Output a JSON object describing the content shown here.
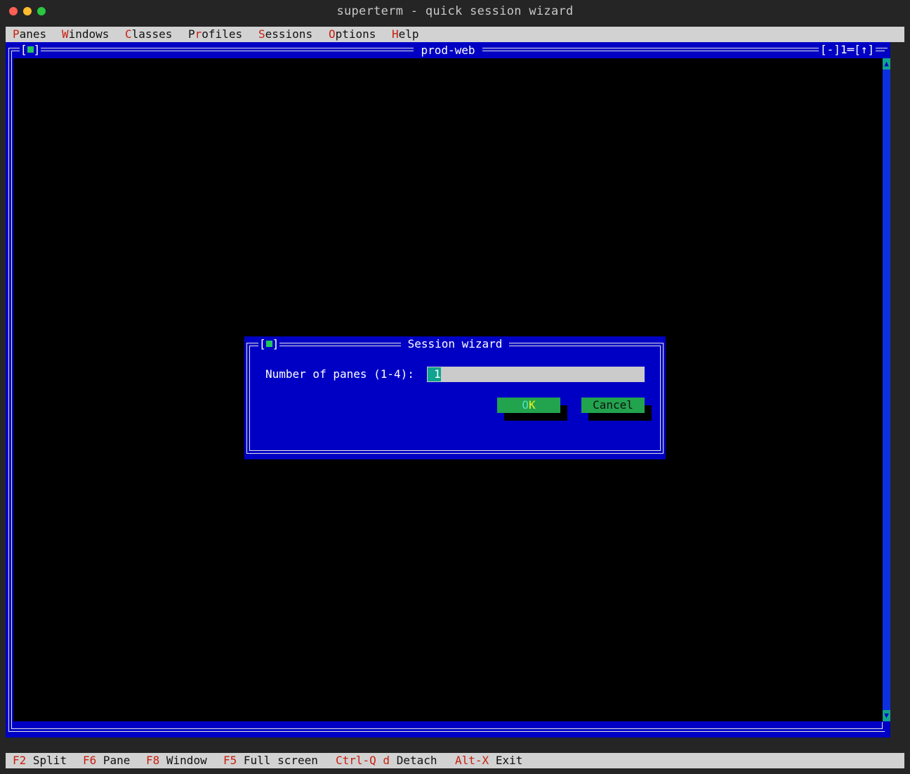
{
  "window": {
    "title": "superterm - quick session wizard"
  },
  "menubar": {
    "items": [
      {
        "hotkey": "P",
        "rest": "anes"
      },
      {
        "hotkey": "W",
        "rest": "indows"
      },
      {
        "hotkey": "C",
        "rest": "lasses"
      },
      {
        "pre": "P",
        "hotkey": "r",
        "rest": "ofiles"
      },
      {
        "hotkey": "S",
        "rest": "essions"
      },
      {
        "hotkey": "O",
        "rest": "ptions"
      },
      {
        "hotkey": "H",
        "rest": "elp"
      }
    ]
  },
  "terminal": {
    "title": "prod-web",
    "window_number": "1",
    "minimize_label": "[-]",
    "zoom_label": "[↑]",
    "scroll_up": "▲",
    "scroll_down": "▼",
    "colors": {
      "frame": "#0000c4",
      "body": "#000000",
      "accent": "#11a38f"
    }
  },
  "dialog": {
    "title": "Session wizard",
    "field_label": "Number of panes (1-4):",
    "field_value": "1",
    "ok_hotkey": "O",
    "ok_rest": "K",
    "cancel_label": "Cancel"
  },
  "statusbar": {
    "items": [
      {
        "key": "F2",
        "label": "Split"
      },
      {
        "key": "F6",
        "label": "Pane"
      },
      {
        "key": "F8",
        "label": "Window"
      },
      {
        "key": "F5",
        "label": "Full screen"
      },
      {
        "key": "Ctrl-Q d",
        "label": "Detach"
      },
      {
        "key": "Alt-X",
        "label": "Exit"
      }
    ]
  }
}
